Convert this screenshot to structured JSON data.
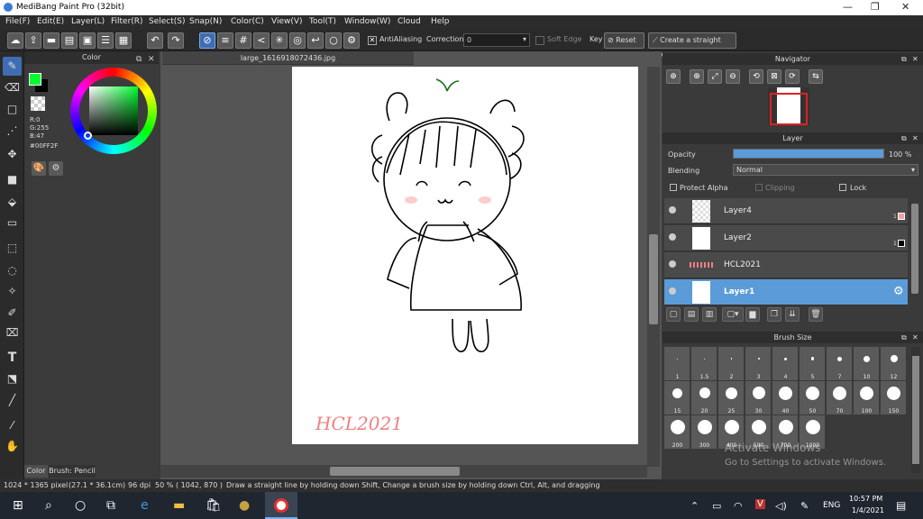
{
  "window": {
    "title": "MediBang Paint Pro (32bit)"
  },
  "menu": [
    "File(F)",
    "Edit(E)",
    "Layer(L)",
    "Filter(R)",
    "Select(S)",
    "Snap(N)",
    "Color(C)",
    "View(V)",
    "Tool(T)",
    "Window(W)",
    "Cloud",
    "Help"
  ],
  "toolbar": {
    "antialiasing": "AntiAliasing",
    "correction_label": "Correction",
    "correction_value": "0",
    "soft_edge": "Soft Edge",
    "key": "Key",
    "reset": "Reset",
    "straight_line": "Create a straight line"
  },
  "color_panel": {
    "title": "Color",
    "r": "R:0",
    "g": "G:255",
    "b": "B:47",
    "hex": "#00FF2F",
    "main_color": "#00ff2f"
  },
  "left_tabs": {
    "color": "Color",
    "brush": "Brush: Pencil"
  },
  "document": {
    "tab": "large_1616918072436.jpg",
    "watermark": "HCL2021"
  },
  "navigator": {
    "title": "Navigator"
  },
  "layer_panel": {
    "title": "Layer",
    "opacity_label": "Opacity",
    "opacity_value": "100 %",
    "opacity_fraction": 1.0,
    "blending_label": "Blending",
    "blending_value": "Normal",
    "protect_alpha": "Protect Alpha",
    "clipping": "Clipping",
    "lock": "Lock",
    "layers": [
      {
        "name": "Layer4",
        "badge": "1"
      },
      {
        "name": "Layer2",
        "badge": "1"
      },
      {
        "name": "HCL2021",
        "badge": ""
      },
      {
        "name": "Layer1",
        "badge": ""
      }
    ]
  },
  "brush_size": {
    "title": "Brush Size",
    "sizes": [
      "1",
      "1.5",
      "2",
      "3",
      "4",
      "5",
      "7",
      "10",
      "12",
      "15",
      "20",
      "25",
      "30",
      "40",
      "50",
      "70",
      "100",
      "150",
      "200",
      "300",
      "400",
      "500",
      "700",
      "1000"
    ]
  },
  "watermark": {
    "line1": "Activate Windows",
    "line2": "Go to Settings to activate Windows."
  },
  "status": {
    "size": "1024 * 1365 pixel",
    "cm": "(27.1 * 36.1cm)",
    "dpi": "96 dpi",
    "zoom": "50 %",
    "coords": "( 1042, 870 )",
    "hint": "Draw a straight line by holding down Shift, Change a brush size by holding down Ctrl, Alt, and dragging"
  },
  "taskbar": {
    "lang": "ENG",
    "time": "10:57 PM",
    "date": "1/4/2021"
  }
}
